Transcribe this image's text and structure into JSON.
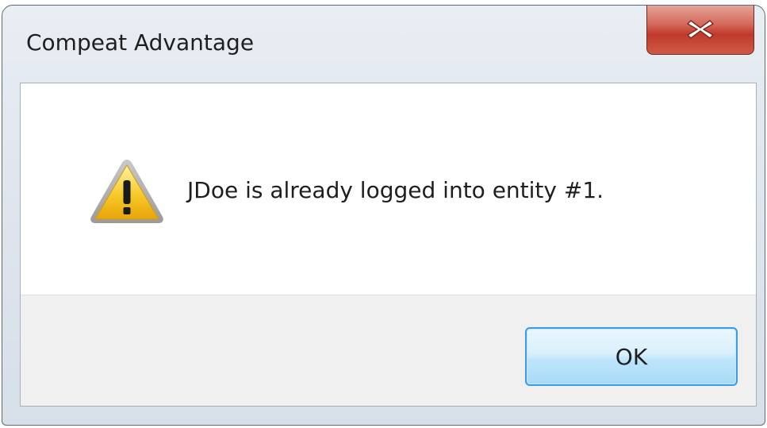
{
  "window": {
    "title": "Compeat Advantage"
  },
  "dialog": {
    "icon": "warning-icon",
    "message": "JDoe is already logged into entity #1.",
    "ok_label": "OK"
  },
  "colors": {
    "close_button": "#c0392b",
    "ok_border": "#3c9be6",
    "warning_yellow": "#f5c518"
  }
}
